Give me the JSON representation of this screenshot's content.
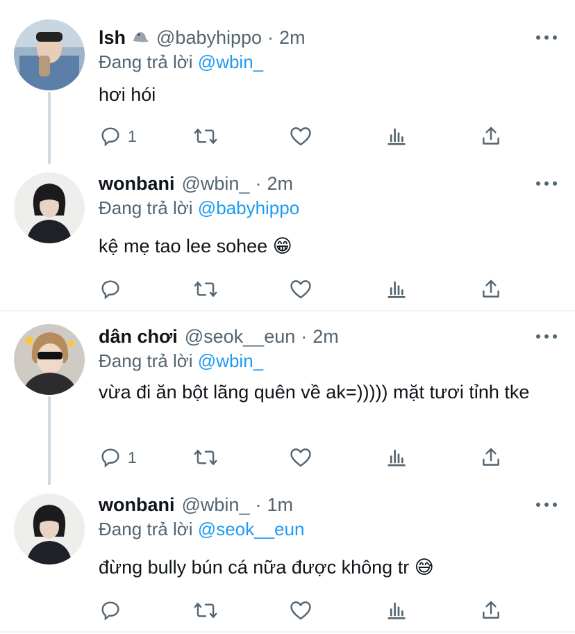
{
  "tweets": [
    {
      "name": "lsh",
      "badge": "seal-emoji",
      "handle": "@babyhippo",
      "time": "2m",
      "replying_prefix": "Đang trả lời",
      "replying_to": "@wbin_",
      "text": "hơi hói",
      "reply_count": "1"
    },
    {
      "name": "wonbani",
      "handle": "@wbin_",
      "time": "2m",
      "replying_prefix": "Đang trả lời",
      "replying_to": "@babyhippo",
      "text": "kệ mẹ tao lee sohee 😁",
      "reply_count": ""
    },
    {
      "name": "dân chơi",
      "handle": "@seok__eun",
      "time": "2m",
      "replying_prefix": "Đang trả lời",
      "replying_to": "@wbin_",
      "text": "vừa đi ăn bột lãng quên về ak=))))) mặt tươi tỉnh tke",
      "reply_count": "1"
    },
    {
      "name": "wonbani",
      "handle": "@wbin_",
      "time": "1m",
      "replying_prefix": "Đang trả lời",
      "replying_to": "@seok__eun",
      "text": "đừng bully bún cá nữa được không tr 😅",
      "reply_count": ""
    }
  ],
  "separator": "·",
  "colors": {
    "text": "#0f1419",
    "secondary": "#536471",
    "accent": "#1d9bf0",
    "thread_line": "#cfd9de",
    "divider": "#eff3f4"
  },
  "icons": [
    "reply-icon",
    "retweet-icon",
    "like-icon",
    "analytics-icon",
    "share-icon",
    "more-icon"
  ]
}
